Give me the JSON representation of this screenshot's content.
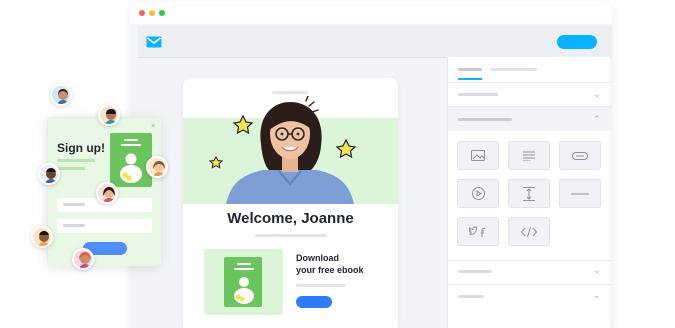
{
  "colors": {
    "accent": "#0ab3ff",
    "cta_blue": "#2f7cf6",
    "hero_green": "#dcf5d8",
    "book_green": "#6bc45e",
    "star_yellow": "#f7e34a"
  },
  "email": {
    "welcome": "Welcome, Joanne",
    "ebook_title_line1": "Download",
    "ebook_title_line2": "your free ebook"
  },
  "popup": {
    "title": "Sign up!",
    "close": "×"
  },
  "icons": {
    "logo": "envelope-icon",
    "blocks": [
      "image-icon",
      "text-icon",
      "button-icon",
      "video-icon",
      "spacer-icon",
      "divider-icon",
      "social-icon",
      "code-icon"
    ]
  }
}
